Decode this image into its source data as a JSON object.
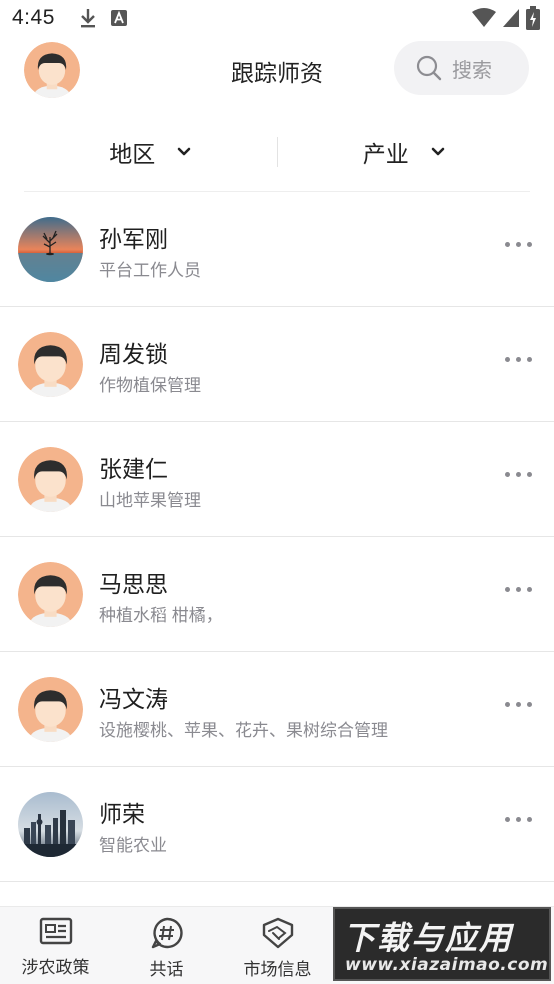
{
  "status_bar": {
    "time": "4:45",
    "icons": [
      "download-icon",
      "a-badge-icon",
      "wifi-icon",
      "signal-icon",
      "battery-icon"
    ]
  },
  "header": {
    "title": "跟踪师资",
    "search_label": "搜索"
  },
  "filters": {
    "region_label": "地区",
    "industry_label": "产业"
  },
  "experts": [
    {
      "name": "孙军刚",
      "desc": "平台工作人员",
      "avatar": "sunset-tree-photo"
    },
    {
      "name": "周发锁",
      "desc": "作物植保管理",
      "avatar": "default-avatar"
    },
    {
      "name": "张建仁",
      "desc": "山地苹果管理",
      "avatar": "default-avatar"
    },
    {
      "name": "马思思",
      "desc": "种植水稻 柑橘，",
      "avatar": "default-avatar"
    },
    {
      "name": "冯文涛",
      "desc": "设施樱桃、苹果、花卉、果树综合管理",
      "avatar": "default-avatar"
    },
    {
      "name": "师荣",
      "desc": "智能农业",
      "avatar": "city-skyline-photo"
    }
  ],
  "bottom_nav": [
    {
      "label": "涉农政策",
      "icon": "policy-icon"
    },
    {
      "label": "共话",
      "icon": "hashtag-chat-icon"
    },
    {
      "label": "市场信息",
      "icon": "handshake-icon"
    }
  ],
  "watermark": {
    "main": "下载与应用",
    "sub": "www.xiazaimao.com"
  },
  "colors": {
    "accent_avatar": "#f4b48c",
    "search_bg": "#f2f2f4",
    "subtext": "#8a8a90"
  }
}
